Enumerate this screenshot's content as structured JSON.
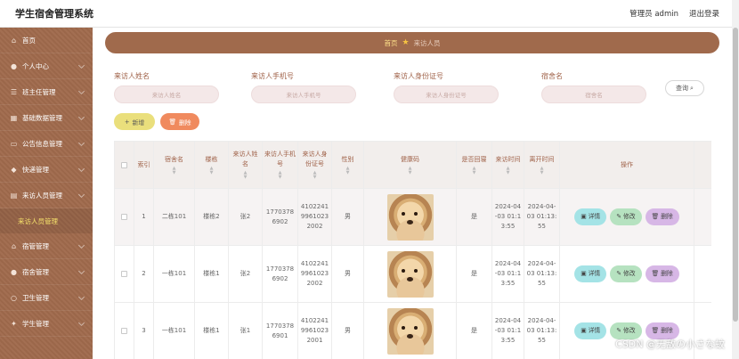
{
  "header": {
    "app_title": "学生宿舍管理系统",
    "user_label": "管理员 admin",
    "logout_label": "退出登录"
  },
  "sidebar": {
    "items": [
      {
        "label": "首页",
        "icon": "home-icon"
      },
      {
        "label": "个人中心",
        "icon": "user-icon"
      },
      {
        "label": "班主任管理",
        "icon": "list-icon"
      },
      {
        "label": "基础数据管理",
        "icon": "grid-icon"
      },
      {
        "label": "公告信息管理",
        "icon": "notice-icon"
      },
      {
        "label": "快递管理",
        "icon": "box-icon"
      },
      {
        "label": "来访人员管理",
        "icon": "visitor-icon"
      }
    ],
    "active_sub": "来访人员管理",
    "items_after": [
      {
        "label": "宿管管理",
        "icon": "house-icon"
      },
      {
        "label": "宿舍管理",
        "icon": "bed-icon"
      },
      {
        "label": "卫生管理",
        "icon": "clean-icon"
      },
      {
        "label": "学生管理",
        "icon": "student-icon"
      }
    ]
  },
  "breadcrumb": {
    "home": "首页",
    "current": "来访人员"
  },
  "search": {
    "fields": [
      {
        "label": "来访人姓名",
        "placeholder": "来访人姓名"
      },
      {
        "label": "来访人手机号",
        "placeholder": "来访人手机号"
      },
      {
        "label": "来访人身份证号",
        "placeholder": "来访人身份证号"
      },
      {
        "label": "宿舍名",
        "placeholder": "宿舍名"
      }
    ],
    "search_button": "查询"
  },
  "actions": {
    "add": "新增",
    "delete": "删除"
  },
  "table": {
    "headers": [
      "索引",
      "宿舍名",
      "楼栋",
      "来访人姓名",
      "来访人手机号",
      "来访人身份证号",
      "性别",
      "健康码",
      "是否回寝",
      "来访时间",
      "离开时间",
      "操作"
    ],
    "rows": [
      {
        "index": "1",
        "dorm": "二栋101",
        "building": "楼栋2",
        "name": "张2",
        "phone": "17703786902",
        "idcard": "410224199610232002",
        "gender": "男",
        "returned": "是",
        "visit_time": "2024-04-03 01:13:55",
        "leave_time": "2024-04-03 01:13:55"
      },
      {
        "index": "2",
        "dorm": "一栋101",
        "building": "楼栋1",
        "name": "张2",
        "phone": "17703786902",
        "idcard": "410224199610232002",
        "gender": "男",
        "returned": "是",
        "visit_time": "2024-04-03 01:13:55",
        "leave_time": "2024-04-03 01:13:55"
      },
      {
        "index": "3",
        "dorm": "一栋101",
        "building": "楼栋1",
        "name": "张1",
        "phone": "17703786901",
        "idcard": "410224199610232001",
        "gender": "男",
        "returned": "是",
        "visit_time": "2024-04-03 01:13:55",
        "leave_time": "2024-04-03 01:13:55"
      }
    ],
    "op_labels": {
      "detail": "详情",
      "edit": "修改",
      "delete": "删除"
    }
  },
  "watermark": "CSDN @无敌の小さな蚊",
  "colors": {
    "sidebar": "#a06a4c",
    "accent_label": "#a0634a",
    "add_btn": "#eadf7c",
    "delete_btn": "#f08a5e"
  }
}
